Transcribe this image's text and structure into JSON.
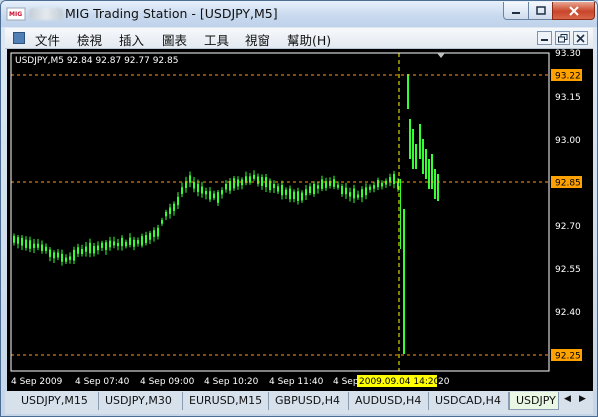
{
  "window": {
    "title": "MIG Trading Station - [USDJPY,M5]",
    "buttons": {
      "minimize": "minimize",
      "maximize": "maximize",
      "close": "close"
    }
  },
  "menu": {
    "items": [
      "文件",
      "檢視",
      "插入",
      "圖表",
      "工具",
      "視窗",
      "幫助(H)"
    ]
  },
  "chart": {
    "header": "USDJPY,M5  92.84 92.87 92.77 92.85",
    "price_labels": [
      "93.30",
      "93.15",
      "93.00",
      "92.70",
      "92.55",
      "92.40"
    ],
    "highlight_labels": {
      "high": "93.22",
      "current": "92.85",
      "low": "92.25"
    },
    "time_labels": [
      "4 Sep 2009",
      "4 Sep 07:40",
      "4 Sep 09:00",
      "4 Sep 10:20",
      "4 Sep 11:40",
      "4 Sep"
    ],
    "crosshair_time": "2009.09.04 14:20",
    "crosshair_suffix": "20",
    "colors": {
      "background": "#000000",
      "candle": "#33ff33",
      "level_line": "#ff9a1a",
      "crosshair": "#ffff00",
      "axis_highlight_bg": "#ffa200",
      "time_highlight_bg": "#ffff00"
    }
  },
  "tabs": [
    "USDJPY,M15",
    "USDJPY,M30",
    "EURUSD,M15",
    "GBPUSD,H4",
    "AUDUSD,H4",
    "USDCAD,H4",
    "USDJPY"
  ],
  "active_tab": "USDJPY"
}
